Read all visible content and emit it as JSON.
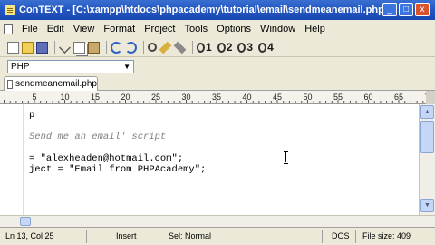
{
  "window": {
    "title": "ConTEXT - [C:\\xampp\\htdocs\\phpacademy\\tutorial\\email\\sendmeanemail.php]",
    "minimize": "_",
    "maximize": "□",
    "close": "x"
  },
  "menu": [
    "File",
    "Edit",
    "View",
    "Format",
    "Project",
    "Tools",
    "Options",
    "Window",
    "Help"
  ],
  "toolbar": {
    "icons": [
      "new-file",
      "open-file",
      "save",
      "cut",
      "copy",
      "paste",
      "undo",
      "redo",
      "find",
      "pencil",
      "tool"
    ],
    "quick_buttons": [
      "1",
      "2",
      "3",
      "4"
    ]
  },
  "highlighter": {
    "selected": "PHP"
  },
  "tabs": [
    {
      "label": "sendmeanemail.php",
      "active": true
    }
  ],
  "ruler": {
    "labels": [
      "5",
      "10",
      "15",
      "20",
      "25",
      "30",
      "35",
      "40",
      "45",
      "50",
      "55",
      "60",
      "65",
      "70"
    ]
  },
  "editor": {
    "lines": [
      {
        "text": "p",
        "color": "#000000"
      },
      {
        "text": "",
        "color": "#000000"
      },
      {
        "text": "Send me an email' script",
        "color": "#808080"
      },
      {
        "text": "",
        "color": "#000000"
      },
      {
        "text": "= \"alexheaden@hotmail.com\";",
        "color": "#000000"
      },
      {
        "text": "ject = \"Email from PHPAcademy\";",
        "color": "#000000"
      }
    ]
  },
  "status": {
    "position": "Ln 13, Col 25",
    "mode": "Insert",
    "selection": "Sel: Normal",
    "format": "DOS",
    "filesize": "File size: 409"
  }
}
